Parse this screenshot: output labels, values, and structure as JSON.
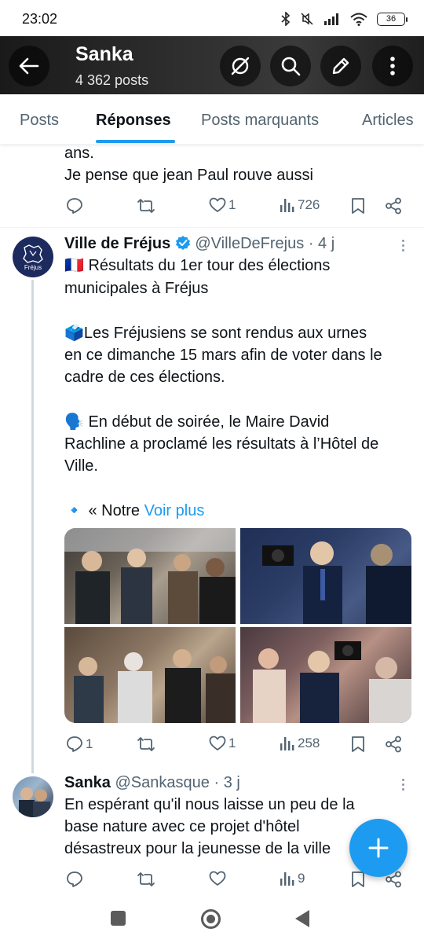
{
  "status_bar": {
    "time": "23:02",
    "battery": "36",
    "icons": [
      "bluetooth-icon",
      "mute-icon",
      "signal-icon",
      "wifi-icon",
      "battery-icon"
    ]
  },
  "profile": {
    "name": "Sanka",
    "post_count": "4 362 posts",
    "icons": [
      "back-arrow-icon",
      "no-location-icon",
      "search-icon",
      "edit-icon",
      "more-vertical-icon"
    ]
  },
  "tabs": [
    {
      "label": "Posts"
    },
    {
      "label": "Réponses",
      "active": true
    },
    {
      "label": "Posts marquants"
    },
    {
      "label": "Articles"
    }
  ],
  "colors": {
    "accent": "#1d9bf0",
    "text": "#0f1419",
    "muted": "#536471",
    "verified": "#1d9bf0"
  },
  "previous_post": {
    "lines": [
      "ans.",
      "Je pense que jean Paul rouve aussi"
    ],
    "actions": {
      "replies": "",
      "reposts": "",
      "likes": "1",
      "views": "726"
    }
  },
  "post_frejus": {
    "name": "Ville de Fréjus",
    "handle": "@VilleDeFrejus",
    "dot": "·",
    "time": "4 j",
    "avatar_label": "Fréjus",
    "lines": [
      "🇫🇷 Résultats du 1er tour des élections",
      "municipales à Fréjus",
      "🗳️Les Fréjusiens se sont rendus aux urnes",
      "en ce dimanche 15 mars afin de voter dans le",
      "cadre de ces élections.",
      "🗣️ En début de soirée, le Maire David",
      "Rachline a proclamé les résultats à l’Hôtel de",
      "Ville."
    ],
    "truncated_prefix": "🔹 « Notre ",
    "see_more": "Voir plus",
    "actions": {
      "replies": "1",
      "reposts": "",
      "likes": "1",
      "views": "258"
    }
  },
  "post_sanka": {
    "name": "Sanka",
    "handle": "@Sankasque",
    "dot": "·",
    "time": "3 j",
    "lines": [
      "En espérant qu'il nous laisse un peu de la",
      "base nature avec ce projet d'hôtel",
      "désastreux pour la jeunesse de la ville"
    ],
    "actions": {
      "replies": "",
      "reposts": "",
      "likes": "",
      "views": "9"
    }
  }
}
